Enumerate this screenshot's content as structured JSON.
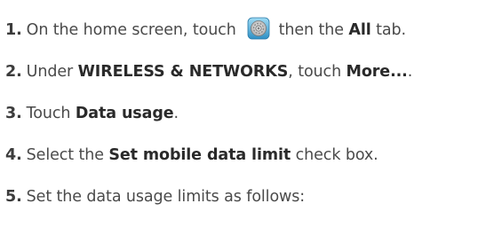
{
  "steps": [
    {
      "number": "1",
      "pre": "On the home screen, touch ",
      "icon": "settings-icon",
      "mid": " then the ",
      "bold": "All",
      "post": " tab."
    },
    {
      "number": "2",
      "pre": "Under ",
      "bold1": "WIRELESS & NETWORKS",
      "mid": ", touch ",
      "bold2": "More...",
      "post": "."
    },
    {
      "number": "3",
      "pre": "Touch ",
      "bold": "Data usage",
      "post": "."
    },
    {
      "number": "4",
      "pre": "Select the ",
      "bold": "Set mobile data limit",
      "post": " check box."
    },
    {
      "number": "5",
      "text": "Set the data usage limits as follows:"
    }
  ]
}
